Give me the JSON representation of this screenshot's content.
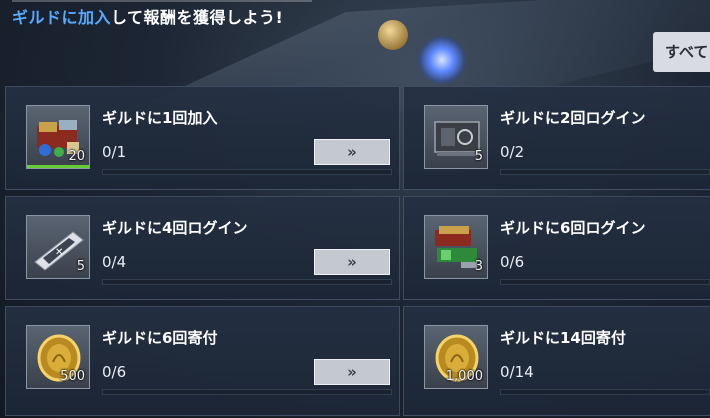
{
  "header": {
    "text_pre": "",
    "text_highlight": "ギルドに加入",
    "text_post": "して報酬を獲得しよう!",
    "all_button": "すべて"
  },
  "missions": [
    {
      "title": "ギルドに1回加入",
      "progress": "0/1",
      "reward_qty": "20",
      "reward_icon": "supply-crate-icon",
      "has_go_button": true,
      "go_label": "»",
      "progress_fraction": 0
    },
    {
      "title": "ギルドに2回ログイン",
      "progress": "0/2",
      "reward_qty": "5",
      "reward_icon": "chip-module-icon",
      "has_go_button": false,
      "progress_fraction": 0
    },
    {
      "title": "ギルドに4回ログイン",
      "progress": "0/4",
      "reward_qty": "5",
      "reward_icon": "ticket-icon",
      "has_go_button": true,
      "go_label": "»",
      "progress_fraction": 0
    },
    {
      "title": "ギルドに6回ログイン",
      "progress": "0/6",
      "reward_qty": "3",
      "reward_icon": "weapon-crate-icon",
      "has_go_button": false,
      "progress_fraction": 0
    },
    {
      "title": "ギルドに6回寄付",
      "progress": "0/6",
      "reward_qty": "500",
      "reward_icon": "gold-coin-icon",
      "has_go_button": true,
      "go_label": "»",
      "progress_fraction": 0
    },
    {
      "title": "ギルドに14回寄付",
      "progress": "0/14",
      "reward_qty": "1,000",
      "reward_icon": "gold-coin-icon",
      "has_go_button": false,
      "progress_fraction": 0
    }
  ],
  "colors": {
    "accent": "#58aaff",
    "completed_strip": "#66cc33"
  }
}
